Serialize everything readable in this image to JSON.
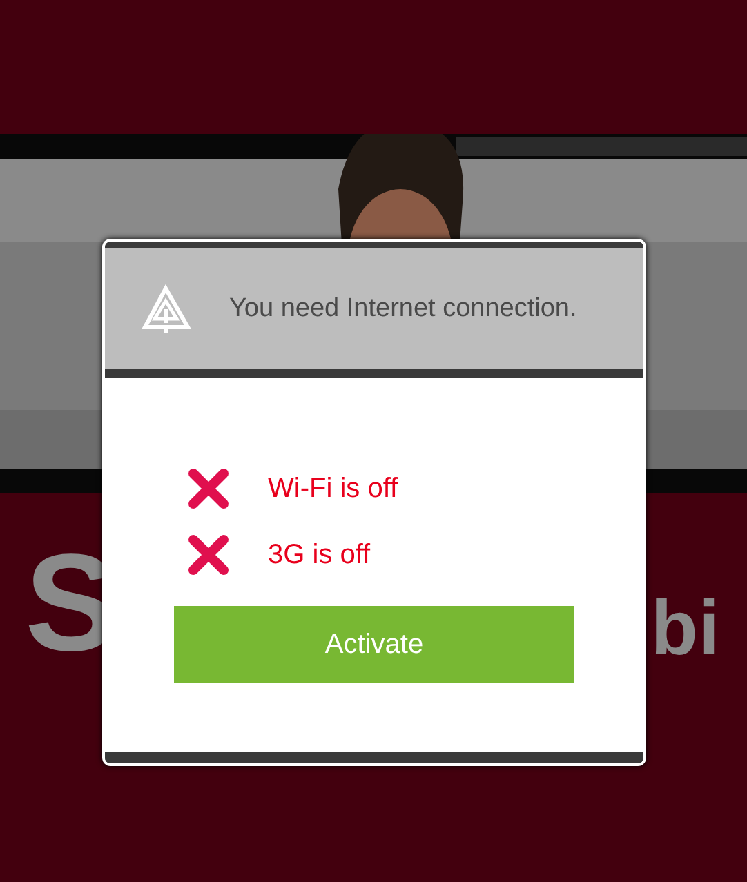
{
  "background": {
    "logo_left": "S",
    "logo_right": "bi"
  },
  "dialog": {
    "message": "You need Internet connection.",
    "connections": [
      {
        "label": "Wi-Fi is off",
        "on": false
      },
      {
        "label": "3G is off",
        "on": false
      }
    ],
    "button": "Activate"
  }
}
